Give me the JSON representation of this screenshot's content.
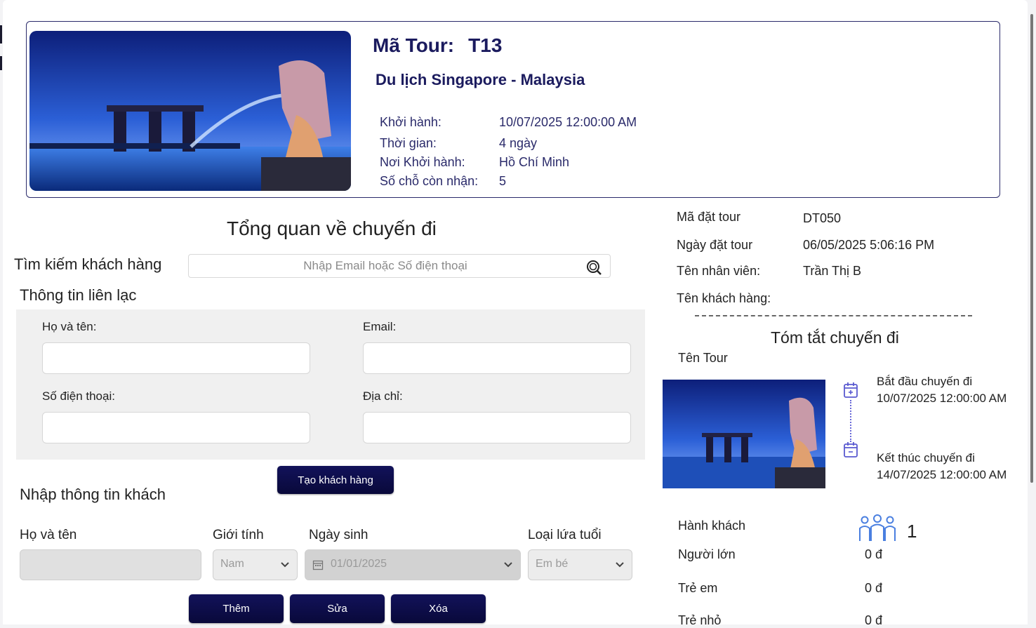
{
  "tour": {
    "code_label": "Mã Tour:",
    "code": "T13",
    "name": "Du lịch Singapore - Malaysia",
    "details": [
      {
        "label": "Khởi hành:",
        "value": "10/07/2025 12:00:00 AM"
      },
      {
        "label": "Thời gian:",
        "value": "4 ngày"
      },
      {
        "label": "Nơi Khởi hành:",
        "value": "Hồ Chí Minh"
      },
      {
        "label": "Số chỗ còn nhận:",
        "value": "5"
      }
    ]
  },
  "overview": {
    "title": "Tổng quan về chuyến đi",
    "search_label": "Tìm kiếm khách hàng",
    "search_placeholder": "Nhập Email hoặc Số điện thoại"
  },
  "contact": {
    "title": "Thông tin liên lạc",
    "fullname_label": "Họ và tên:",
    "email_label": "Email:",
    "phone_label": "Số điện thoại:",
    "address_label": "Địa chỉ:",
    "create_button": "Tạo khách hàng"
  },
  "guest": {
    "title": "Nhập thông tin khách",
    "headers": [
      "Họ và tên",
      "Giới tính",
      "Ngày sinh",
      "Loại lứa tuổi"
    ],
    "gender_value": "Nam",
    "dob_value": "01/01/2025",
    "age_type_value": "Em bé",
    "buttons": {
      "add": "Thêm",
      "edit": "Sửa",
      "delete": "Xóa"
    }
  },
  "booking": {
    "rows": [
      {
        "label": "Mã đặt tour",
        "value": "DT050"
      },
      {
        "label": "Ngày đặt tour",
        "value": "06/05/2025 5:06:16 PM"
      },
      {
        "label": "Tên nhân viên:",
        "value": "Trần Thị B"
      },
      {
        "label": "Tên khách hàng:",
        "value": ""
      }
    ]
  },
  "summary": {
    "title": "Tóm tắt chuyến đi",
    "tour_name_label": "Tên Tour",
    "start_label": "Bắt đầu chuyến đi",
    "start_value": "10/07/2025 12:00:00 AM",
    "end_label": "Kết thúc chuyến đi",
    "end_value": "14/07/2025 12:00:00 AM",
    "passengers_label": "Hành khách",
    "passengers_count": "1",
    "prices": [
      {
        "label": "Người lớn",
        "value": "0 đ"
      },
      {
        "label": "Trẻ em",
        "value": "0 đ"
      },
      {
        "label": "Trẻ nhỏ",
        "value": "0 đ"
      }
    ]
  },
  "colors": {
    "brand": "#1b1b5e",
    "button": "#0f0f4f",
    "icon": "#5a5ad0"
  }
}
